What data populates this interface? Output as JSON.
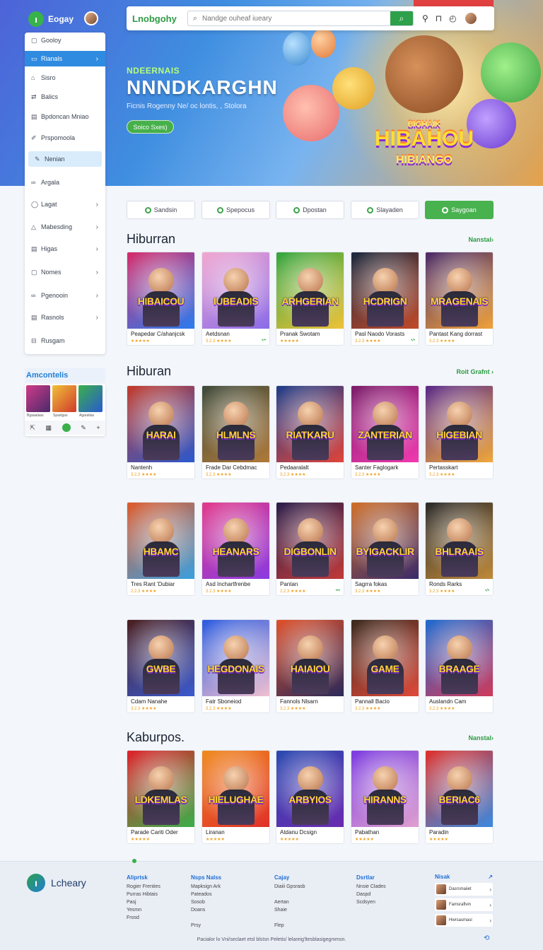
{
  "header": {
    "brand": "Eogay",
    "site_name": "Lnobgohy",
    "search_placeholder": "Nandge ouheaf iueary",
    "icons": [
      "search-icon",
      "pin-icon",
      "bag-icon",
      "clock-icon"
    ],
    "red_tag": ""
  },
  "hero": {
    "kicker": "NDEERNAIS",
    "title": "NNNDKARGHN",
    "subtitle": "Ficnis Rogenny Ne/ oc lontis, , Stolora",
    "button": "Soico Sxes)",
    "game_title": "HIBAHOU",
    "game_small": "HIBIANGO",
    "game_top": "BIGHAIK"
  },
  "sidebar": {
    "items": [
      {
        "label": "Gooloy",
        "icon": "square-icon",
        "chevron": ""
      },
      {
        "label": "Rianals",
        "icon": "window-icon",
        "chevron": "›"
      },
      {
        "label": "Sisro",
        "icon": "shop-icon",
        "chevron": ""
      },
      {
        "label": "Balics",
        "icon": "share-icon",
        "chevron": ""
      },
      {
        "label": "Bpdoncan Mniao",
        "icon": "doc-icon",
        "chevron": ""
      },
      {
        "label": "Prspomoola",
        "icon": "brush-icon",
        "chevron": ""
      },
      {
        "label": "Nenian",
        "icon": "edit-icon",
        "chevron": ""
      },
      {
        "label": "Argala",
        "icon": "link-icon",
        "chevron": ""
      },
      {
        "label": "Lagat",
        "icon": "chat-icon",
        "chevron": "›"
      },
      {
        "label": "Mabesding",
        "icon": "triangle-icon",
        "chevron": "›"
      },
      {
        "label": "Higas",
        "icon": "doc-icon",
        "chevron": "›"
      },
      {
        "label": "Nomes",
        "icon": "square-icon",
        "chevron": "›"
      },
      {
        "label": "Pgenooin",
        "icon": "link-icon",
        "chevron": "›"
      },
      {
        "label": "Rasnols",
        "icon": "doc-icon",
        "chevron": "›"
      },
      {
        "label": "Rusgam",
        "icon": "bus-icon",
        "chevron": ""
      }
    ],
    "widget_title": "Amcontelis",
    "widget_labels": [
      "Bgaaalaas",
      "Spaslgas",
      "Agaraltas"
    ]
  },
  "tabs": [
    {
      "label": "Sandsin",
      "active": false
    },
    {
      "label": "Spepocus",
      "active": false
    },
    {
      "label": "Dpostan",
      "active": false
    },
    {
      "label": "Slayaden",
      "active": false
    },
    {
      "label": "Saygoan",
      "active": true
    }
  ],
  "sections": [
    {
      "title": "Hiburran",
      "link": "Nanstal›",
      "cards": [
        {
          "name": "Peapedar C/ahanjcsk",
          "rating": "★★★★★",
          "extra": "",
          "art": "HIBAICOU",
          "c1": "#d62b6a",
          "c2": "#2a7cf0"
        },
        {
          "name": "Aetdsnan",
          "rating": "3.2.3 ★★★★",
          "extra": "•/•",
          "art": "IUBEADIS",
          "c1": "#f2a7d0",
          "c2": "#8a6be8"
        },
        {
          "name": "Pranak Swotam",
          "rating": "★★★★★",
          "extra": "",
          "art": "ARHGERIAN",
          "c1": "#33a63f",
          "c2": "#f0c23a"
        },
        {
          "name": "Pasl Naodo Vorasts",
          "rating": "3.2.3 ★★★★",
          "extra": "•/•",
          "art": "HCDRIGN",
          "c1": "#1b2a3e",
          "c2": "#c24a2a"
        },
        {
          "name": "Pantast Kang dorrast",
          "rating": "3.2.3 ★★★★",
          "extra": "",
          "art": "MRAGENAIS",
          "c1": "#4a2c6a",
          "c2": "#f0a23a"
        }
      ]
    },
    {
      "title": "Hiburan",
      "link": "Roit Grafnt ›",
      "cards": [
        {
          "name": "Nantenh",
          "rating": "3.2.3 ★★★★",
          "extra": "",
          "art": "HARAI",
          "c1": "#c43b2a",
          "c2": "#2a5ad0"
        },
        {
          "name": "Frade Dar Cebdmac",
          "rating": "3.2.3 ★★★★",
          "extra": "",
          "art": "HLMLNS",
          "c1": "#3e4a3a",
          "c2": "#b07a3a"
        },
        {
          "name": "Pedaaralalt",
          "rating": "3.2.3 ★★★★",
          "extra": "",
          "art": "RIATKARU",
          "c1": "#1e3e8a",
          "c2": "#e0453a"
        },
        {
          "name": "Santer Faglogark",
          "rating": "3.2.3 ★★★★",
          "extra": "",
          "art": "ZANTERIAN",
          "c1": "#7a1e6a",
          "c2": "#f23ab0"
        },
        {
          "name": "Pertasskart",
          "rating": "3.2.3 ★★★★",
          "extra": "",
          "art": "HIGEBIAN",
          "c1": "#5a2a8a",
          "c2": "#f0a83a"
        }
      ]
    },
    {
      "title": "",
      "link": "",
      "cards": [
        {
          "name": "Tres Rant 'Dubiar",
          "rating": "2.2.3 ★★★★",
          "extra": "",
          "art": "HBAMC",
          "c1": "#e05a2a",
          "c2": "#3aa0e0"
        },
        {
          "name": "Asd Inchartfrenbe",
          "rating": "3.2.3 ★★★★",
          "extra": "",
          "art": "HEANARS",
          "c1": "#e23a8a",
          "c2": "#8a3ae0"
        },
        {
          "name": "Pantan",
          "rating": "2.2.3 ★★★★",
          "extra": "•••",
          "art": "DIGBONLIN",
          "c1": "#2a1e4a",
          "c2": "#c03a3a"
        },
        {
          "name": "Sagrra fokas",
          "rating": "3.2.3 ★★★★",
          "extra": "",
          "art": "BYIGACKLIR",
          "c1": "#d0702a",
          "c2": "#3a2a6a"
        },
        {
          "name": "Ronds Rarks",
          "rating": "3.2.3 ★★★★",
          "extra": "•/•",
          "art": "BHLRAAIS",
          "c1": "#2a2a2a",
          "c2": "#c08a3a"
        }
      ]
    },
    {
      "title": "",
      "link": "",
      "cards": [
        {
          "name": "Cdam Nanahe",
          "rating": "3.2.3 ★★★★",
          "extra": "",
          "art": "GWBE",
          "c1": "#4a1e1e",
          "c2": "#3a5ad0"
        },
        {
          "name": "Fatr Sboneiod",
          "rating": "3.2.3 ★★★★",
          "extra": "",
          "art": "HEGDONAIS",
          "c1": "#2a5ae0",
          "c2": "#f0c0d0"
        },
        {
          "name": "Fannols Nlsarn",
          "rating": "3.2.3 ★★★★",
          "extra": "",
          "art": "HAIAIOU",
          "c1": "#e0502a",
          "c2": "#2a2a5a"
        },
        {
          "name": "Pannall Bacio",
          "rating": "3.2.3 ★★★★",
          "extra": "",
          "art": "GAME",
          "c1": "#3a2a1e",
          "c2": "#e04a3a"
        },
        {
          "name": "Auslandn Cam",
          "rating": "3.2.3 ★★★★",
          "extra": "",
          "art": "BRAAGE",
          "c1": "#1e6ad0",
          "c2": "#d03a5a"
        }
      ]
    },
    {
      "title": "Kaburpos.",
      "link": "Nanstal›",
      "cards": [
        {
          "name": "Parade Cariti Oder",
          "rating": "★★★★★",
          "extra": "",
          "art": "LDKEMLAS",
          "c1": "#e0202a",
          "c2": "#3ab04a"
        },
        {
          "name": "Liranan",
          "rating": "★★★★★",
          "extra": "",
          "art": "HIELUGHAE",
          "c1": "#f08a1e",
          "c2": "#e0302a"
        },
        {
          "name": "Atdanu Dcsign",
          "rating": "★★★★★",
          "extra": "",
          "art": "ARBYIOS",
          "c1": "#2a4ab0",
          "c2": "#6a2ab0"
        },
        {
          "name": "Pabathan",
          "rating": "★★★★★",
          "extra": "",
          "art": "HIRANNS",
          "c1": "#7a3ae0",
          "c2": "#e0a0d0"
        },
        {
          "name": "Paradin",
          "rating": "★★★★★",
          "extra": "",
          "art": "BERIAC6",
          "c1": "#e0302a",
          "c2": "#3a8ae0"
        }
      ]
    }
  ],
  "footer": {
    "brand": "Lcheary",
    "cols": [
      {
        "title": "Aliprtsk",
        "lines": [
          "Rogier Frenties",
          "Purras Hibtais",
          "Pasj",
          "Yesmn",
          "Frosd"
        ]
      },
      {
        "title": "Nsps Nalss",
        "lines": [
          "Mapksign Ark",
          "Pateados",
          "Sosob",
          "Doans",
          "",
          "Prsy"
        ]
      },
      {
        "title": "Cajay",
        "lines": [
          "Diaiii Gpsrasb",
          "",
          "Aertan",
          "Shaie",
          "",
          "Flep"
        ]
      },
      {
        "title": "Dsrtlar",
        "lines": [
          "Nnsie Clades",
          "Daspd",
          "Scdsyen"
        ]
      }
    ],
    "news_title": "Nisak",
    "news": [
      "Dasrsmaiiet",
      "Famsraflvin",
      "Hwrsasmasi"
    ],
    "copyright": "Pacialor lo Vni/seclaet etsl blsIsn Peletis/ lelareig'ltesblasigegmmsn."
  }
}
